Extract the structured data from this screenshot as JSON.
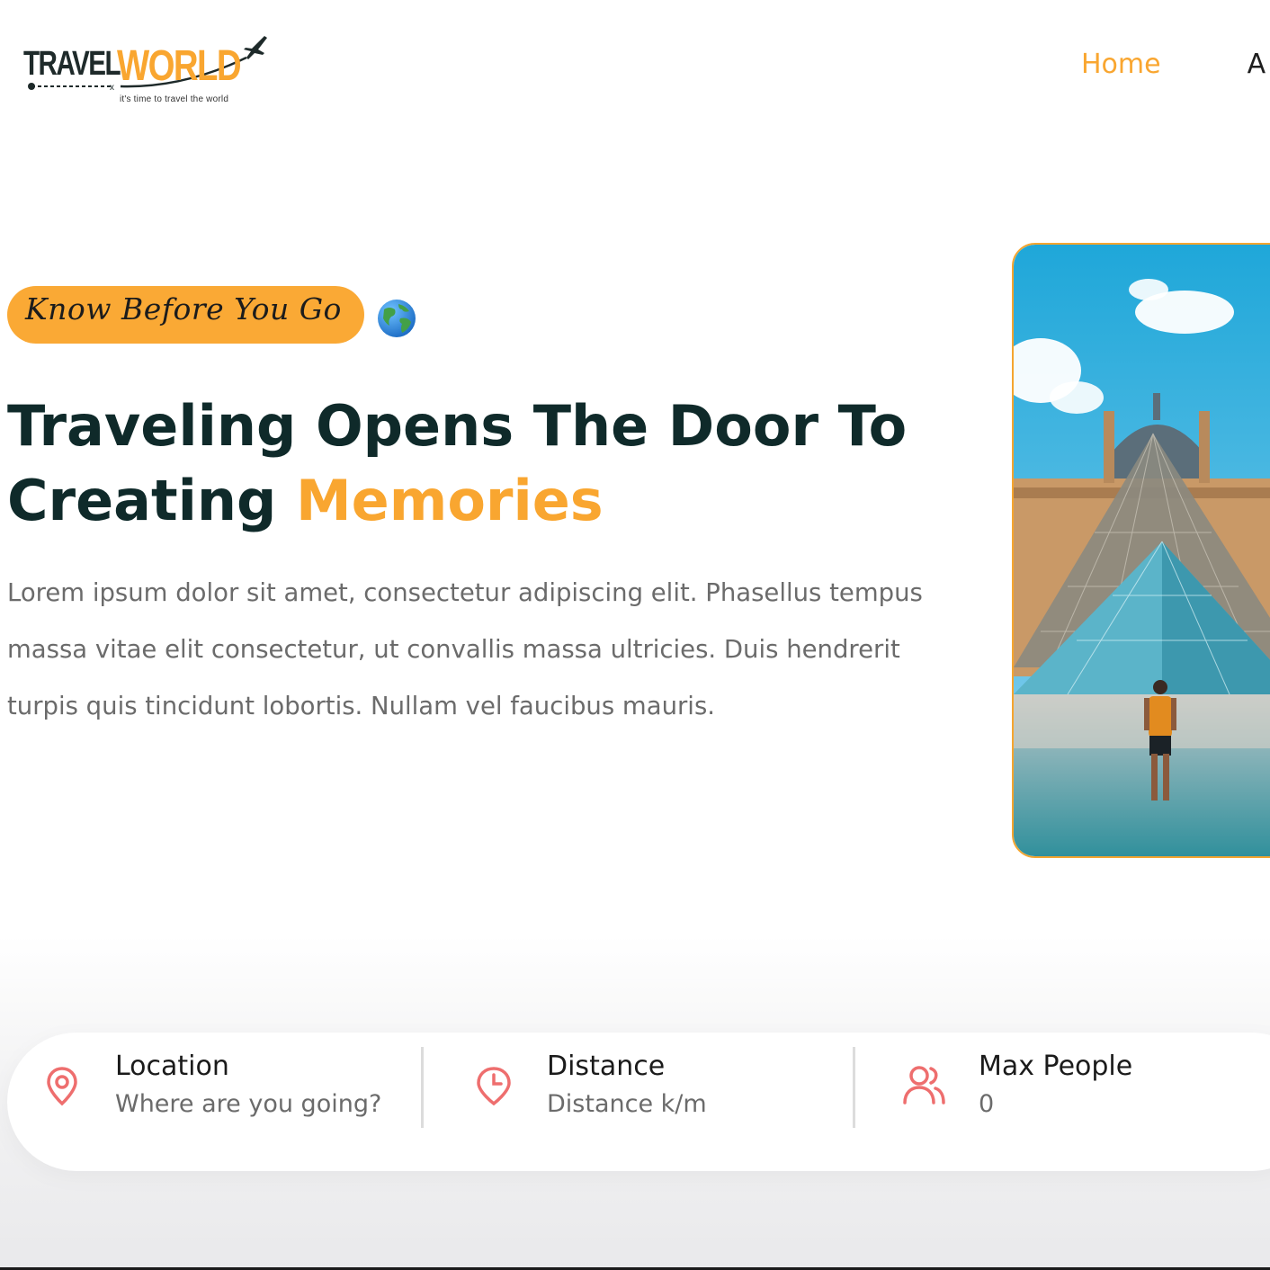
{
  "brand": {
    "name_part1": "TRAVEL",
    "name_part2": "WORLD",
    "tagline": "it's time to travel the world"
  },
  "nav": {
    "items": [
      {
        "label": "Home",
        "active": true
      },
      {
        "label": "A",
        "active": false
      }
    ]
  },
  "hero": {
    "badge_text": "Know Before You Go",
    "badge_icon": "globe-icon",
    "title_line1": "Traveling Opens The Door To",
    "title_line2_prefix": "Creating ",
    "title_highlight": "Memories",
    "description": "Lorem ipsum dolor sit amet, consectetur adipiscing elit. Phasellus tempus massa vitae elit consectetur, ut convallis massa ultricies. Duis hendrerit turpis quis tincidunt lobortis. Nullam vel faucibus mauris."
  },
  "search": {
    "location": {
      "label": "Location",
      "placeholder": "Where are you going?",
      "icon": "map-pin-icon"
    },
    "distance": {
      "label": "Distance",
      "placeholder": "Distance k/m",
      "icon": "clock-pin-icon"
    },
    "max_people": {
      "label": "Max People",
      "placeholder": "0",
      "icon": "group-icon"
    }
  },
  "colors": {
    "accent": "#f9a630",
    "heading": "#0f2a2a",
    "text_muted": "#6b6b6b",
    "icon_red": "#ee6e6e"
  }
}
